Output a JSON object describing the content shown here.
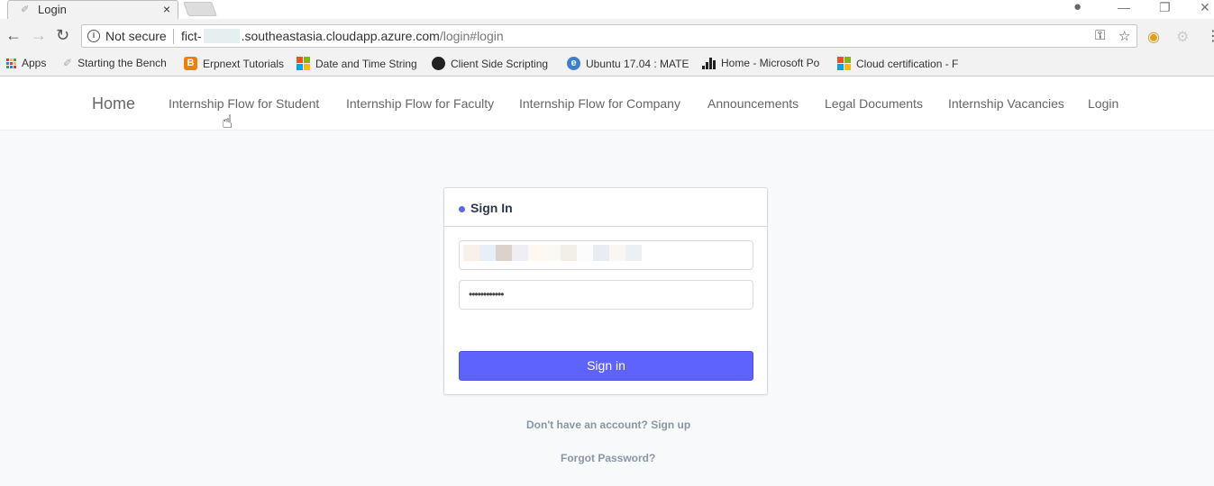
{
  "browser": {
    "tab_title": "Login",
    "tab_close": "×",
    "address": {
      "security_label": "Not secure",
      "url_prefix": "fict-",
      "url_domain": ".southeastasia.cloudapp.azure.com",
      "url_path": "/login#login"
    },
    "bookmarks": [
      {
        "label": "Apps",
        "icon": "apps-grid-icon"
      },
      {
        "label": "Starting the Bench",
        "icon": "bookmark-favicon-icon"
      },
      {
        "label": "Erpnext Tutorials",
        "icon": "blogger-icon"
      },
      {
        "label": "Date and Time String",
        "icon": "microsoft-logo-icon"
      },
      {
        "label": "Client Side Scripting",
        "icon": "github-icon"
      },
      {
        "label": "Ubuntu 17.04 : MATE",
        "icon": "ie-icon"
      },
      {
        "label": "Home - Microsoft Po",
        "icon": "signal-bars-icon"
      },
      {
        "label": "Cloud certification - F",
        "icon": "microsoft-logo-icon"
      }
    ]
  },
  "site_nav": {
    "home": "Home",
    "links": [
      "Internship Flow for Student",
      "Internship Flow for Faculty",
      "Internship Flow for Company",
      "Announcements",
      "Legal Documents",
      "Internship Vacancies",
      "Login"
    ]
  },
  "signin_card": {
    "title": "Sign In",
    "email_value": "",
    "password_value": "••••••••••••",
    "submit_label": "Sign in",
    "accent_color": "#5f63fe"
  },
  "footer_links": {
    "signup": "Don't have an account? Sign up",
    "forgot": "Forgot Password?"
  }
}
